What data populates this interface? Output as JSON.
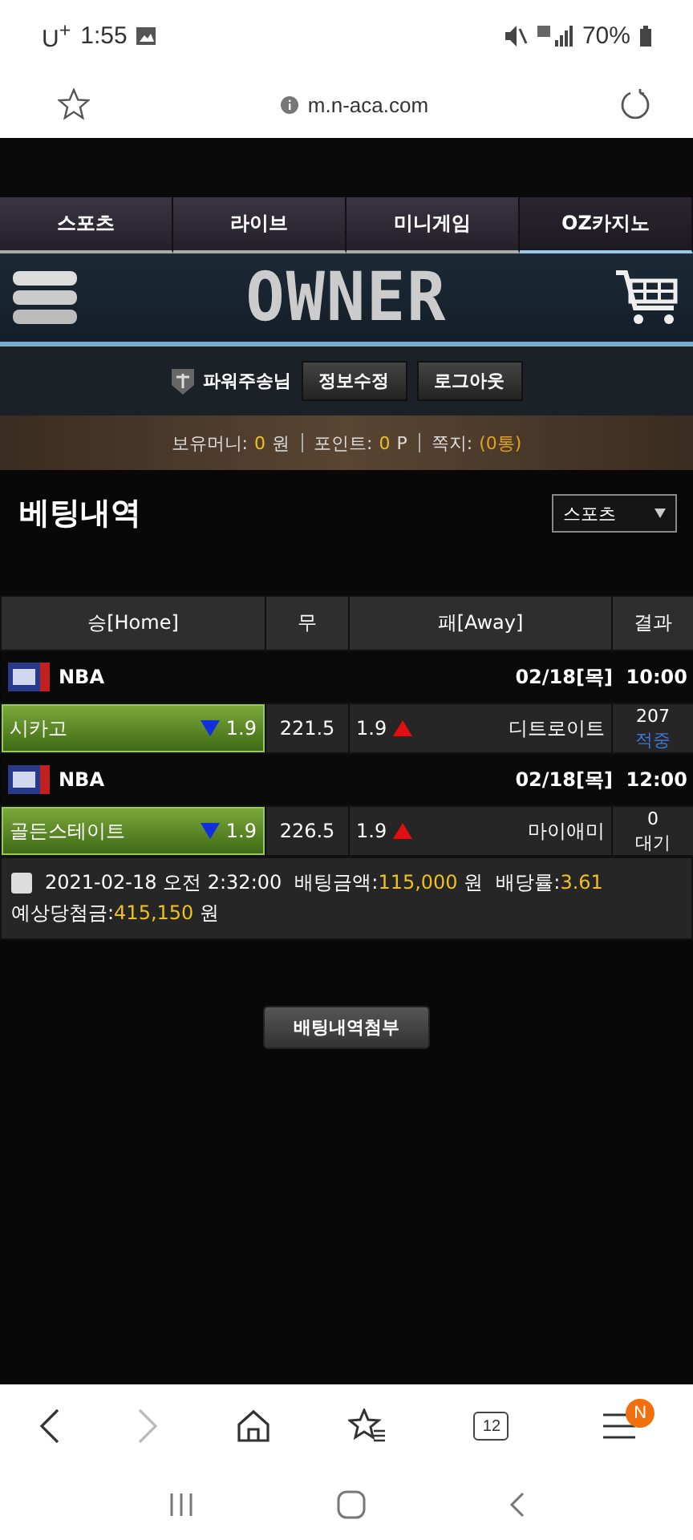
{
  "status_bar": {
    "carrier": "U$^{+}$",
    "time": "1:55",
    "battery": "70%"
  },
  "address_bar": {
    "url": "m.n-aca.com"
  },
  "tabs": [
    {
      "label": "스포츠",
      "selected": false
    },
    {
      "label": "라이브",
      "selected": false
    },
    {
      "label": "미니게임",
      "selected": false
    },
    {
      "label": "OZ카지노",
      "selected": true
    }
  ],
  "header": {
    "logo": "OWNER"
  },
  "user_bar": {
    "name": "파워주송님",
    "buttons": [
      "정보수정",
      "로그아웃"
    ]
  },
  "balance_bar": {
    "items": [
      {
        "label": "보유머니:",
        "value": "0",
        "unit": "원"
      },
      {
        "label": "포인트:",
        "value": "0",
        "unit": "P"
      },
      {
        "label": "쪽지:",
        "value": "(0통)"
      }
    ]
  },
  "page_title": "베팅내역",
  "filter": {
    "value": "스포츠"
  },
  "table": {
    "columns": [
      "승[Home]",
      "무",
      "패[Away]",
      "결과"
    ],
    "games": [
      {
        "league": "NBA",
        "date": "02/18[목]",
        "time": "10:00",
        "home": "시카고",
        "home_odds": "1.9",
        "home_odds_falling": true,
        "home_selected": true,
        "draw": "221.5",
        "away_odds": "1.9",
        "away_odds_rising": true,
        "away": "디트로이트",
        "away_selected": false,
        "score": "207",
        "result": "적중",
        "won": true
      },
      {
        "league": "NBA",
        "date": "02/18[목]",
        "time": "12:00",
        "home": "골든스테이트",
        "home_odds": "1.9",
        "home_odds_falling": true,
        "home_selected": true,
        "draw": "226.5",
        "away_odds": "1.9",
        "away_odds_rising": true,
        "away": "마이애미",
        "away_selected": false,
        "score": "0",
        "result": "대기",
        "won": false
      }
    ]
  },
  "summary": {
    "checked": false,
    "datetime": "2021-02-18 오전 2:32:00",
    "fields": [
      {
        "label": "배팅금액:",
        "value": "115,000",
        "unit": "원"
      },
      {
        "label": "배당률:",
        "value": "3.61"
      },
      {
        "label": "예상당첨금:",
        "value": "415,150",
        "unit": "원"
      }
    ]
  },
  "attach_button": "배팅내역첨부",
  "browser_nav": {
    "forward_disabled": true,
    "tab_count": "12",
    "menu_badge": "N"
  }
}
